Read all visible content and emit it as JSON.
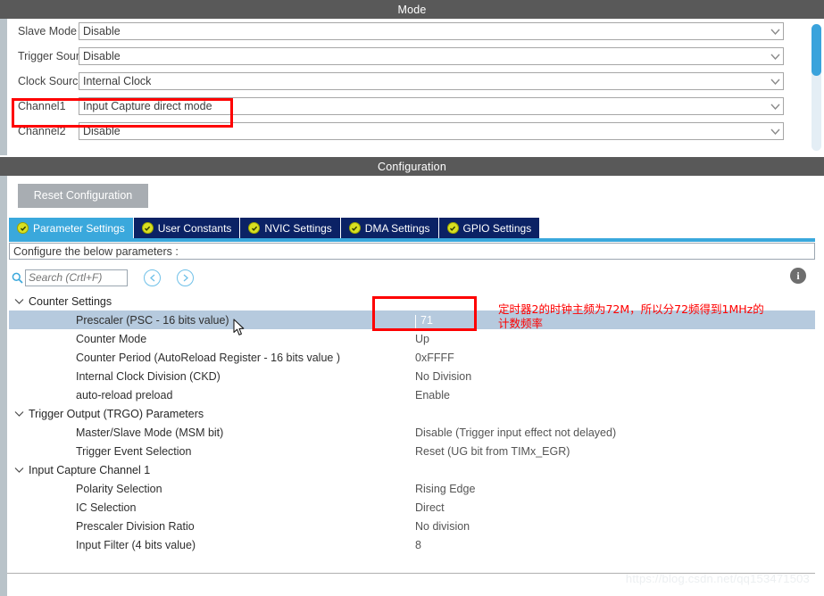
{
  "mode_panel": {
    "title": "Mode",
    "rows": [
      {
        "label": "Slave Mode",
        "value": "Disable"
      },
      {
        "label": "Trigger Source",
        "value": "Disable"
      },
      {
        "label": "Clock Source",
        "value": "Internal Clock"
      },
      {
        "label": "Channel1",
        "value": "Input Capture direct mode"
      },
      {
        "label": "Channel2",
        "value": "Disable"
      }
    ]
  },
  "config_panel": {
    "title": "Configuration",
    "reset_label": "Reset Configuration",
    "tabs": [
      {
        "label": "Parameter Settings",
        "active": true
      },
      {
        "label": "User Constants",
        "active": false
      },
      {
        "label": "NVIC Settings",
        "active": false
      },
      {
        "label": "DMA Settings",
        "active": false
      },
      {
        "label": "GPIO Settings",
        "active": false
      }
    ],
    "configure_note": "Configure the below parameters :",
    "search_placeholder": "Search (Crtl+F)",
    "info_glyph": "i",
    "groups": [
      {
        "name": "Counter Settings",
        "params": [
          {
            "name": "Prescaler (PSC - 16 bits value)",
            "value": "71",
            "selected": true,
            "editing": true
          },
          {
            "name": "Counter Mode",
            "value": "Up",
            "selected": false,
            "editing": false
          },
          {
            "name": "Counter Period (AutoReload Register - 16 bits value )",
            "value": "0xFFFF",
            "selected": false,
            "editing": false
          },
          {
            "name": "Internal Clock Division (CKD)",
            "value": "No Division",
            "selected": false,
            "editing": false
          },
          {
            "name": "auto-reload preload",
            "value": "Enable",
            "selected": false,
            "editing": false
          }
        ]
      },
      {
        "name": "Trigger Output (TRGO) Parameters",
        "params": [
          {
            "name": "Master/Slave Mode (MSM bit)",
            "value": "Disable (Trigger input effect not delayed)",
            "selected": false,
            "editing": false
          },
          {
            "name": "Trigger Event Selection",
            "value": "Reset (UG bit from TIMx_EGR)",
            "selected": false,
            "editing": false
          }
        ]
      },
      {
        "name": "Input Capture Channel 1",
        "params": [
          {
            "name": "Polarity Selection",
            "value": "Rising Edge",
            "selected": false,
            "editing": false
          },
          {
            "name": "IC Selection",
            "value": "Direct",
            "selected": false,
            "editing": false
          },
          {
            "name": "Prescaler Division Ratio",
            "value": "No division",
            "selected": false,
            "editing": false
          },
          {
            "name": "Input Filter (4 bits value)",
            "value": "8",
            "selected": false,
            "editing": false
          }
        ]
      }
    ]
  },
  "annotations": {
    "chinese_note": "定时器2的时钟主频为72M，所以分72频得到1MHz的\n计数频率",
    "note_color": "#fe0000",
    "highlight_box_color": "#fe0000"
  },
  "watermark": "https://blog.csdn.net/qq153471503",
  "colors": {
    "header_bar": "#595959",
    "tab_active": "#3aa8dc",
    "tab_inactive": "#0b2265",
    "row_selected": "#b6cade",
    "scrollbar_thumb": "#3aa3dc",
    "reset_button": "#a8adb2"
  }
}
